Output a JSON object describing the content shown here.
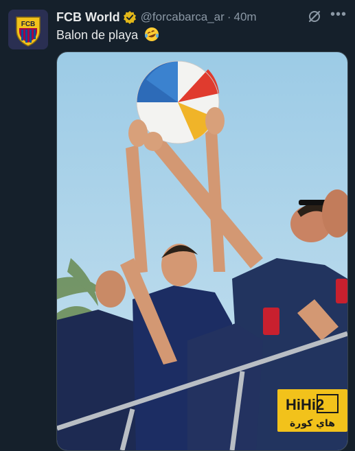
{
  "account": {
    "display_name": "FCB World",
    "handle": "@forcabarca_ar",
    "separator": "·",
    "time_ago": "40m",
    "avatar_text": "FCB",
    "verified_icon": "verified-badge-icon"
  },
  "post": {
    "text": "Balon de playa",
    "emoji": "rolling-on-floor-laughing-emoji"
  },
  "actions": {
    "grok_icon": "grok-icon",
    "more_label": "•••"
  },
  "watermark": {
    "brand": "HiHi2",
    "arabic": "هاي كورة"
  },
  "colors": {
    "background": "#15202b",
    "text": "#e7e9ea",
    "secondary": "#8b98a5",
    "verified": "#e2b719",
    "watermark": "#f2c21b"
  }
}
